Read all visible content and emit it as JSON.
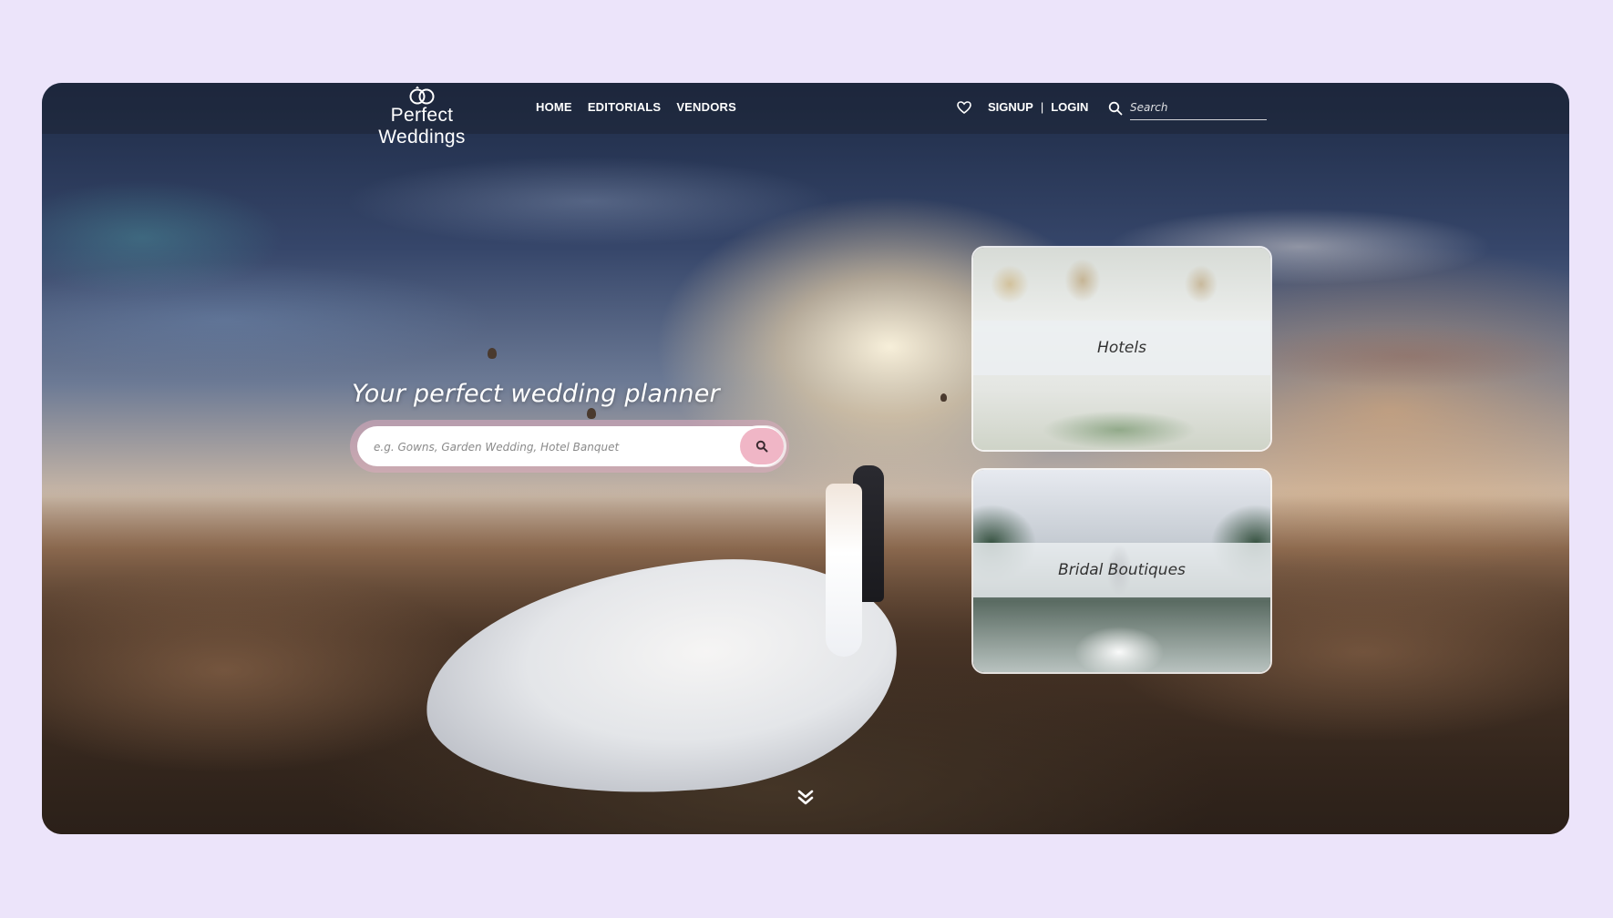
{
  "brand": {
    "name": "Perfect Weddings",
    "logo_icon": "rings-icon"
  },
  "nav": {
    "links": [
      "HOME",
      "EDITORIALS",
      "VENDORS"
    ],
    "favorites_icon": "heart-icon",
    "signup_label": "SIGNUP",
    "separator": "|",
    "login_label": "LOGIN",
    "search_placeholder": "Search",
    "search_icon": "search-icon"
  },
  "hero": {
    "title": "Your perfect wedding planner",
    "search_placeholder": "e.g. Gowns, Garden Wedding, Hotel Banquet",
    "search_button_icon": "search-icon",
    "accent_color": "#f0b6c6"
  },
  "categories": [
    {
      "label": "Hotels"
    },
    {
      "label": "Bridal Boutiques"
    }
  ],
  "scroll_icon": "chevron-double-down-icon",
  "colors": {
    "page_background": "#ece4fa",
    "nav_text": "#ffffff"
  }
}
